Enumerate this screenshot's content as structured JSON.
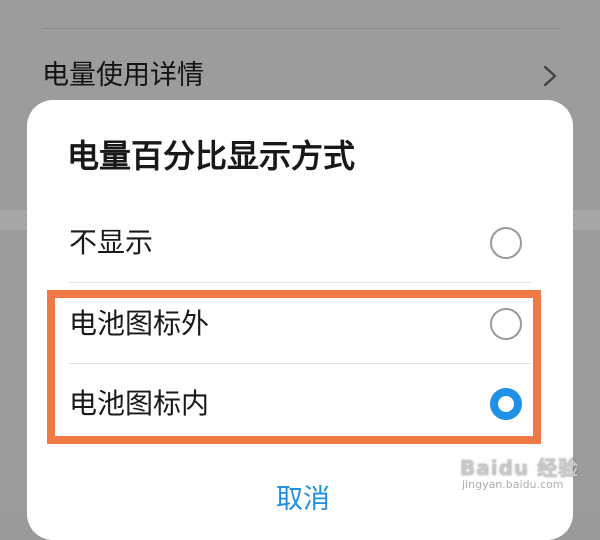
{
  "background": {
    "row_label": "电量使用详情",
    "chevron_icon": "chevron-right-icon"
  },
  "dialog": {
    "title": "电量百分比显示方式",
    "options": [
      {
        "label": "不显示",
        "selected": false
      },
      {
        "label": "电池图标外",
        "selected": false
      },
      {
        "label": "电池图标内",
        "selected": true
      }
    ],
    "cancel_label": "取消"
  },
  "annotation": {
    "highlight_color": "#f07a45"
  },
  "colors": {
    "accent": "#1e90e6",
    "dim_overlay": "#9c9c9c"
  },
  "watermark": {
    "logo_text": "Baidu 经验",
    "url_text": "jingyan.baidu.com"
  }
}
